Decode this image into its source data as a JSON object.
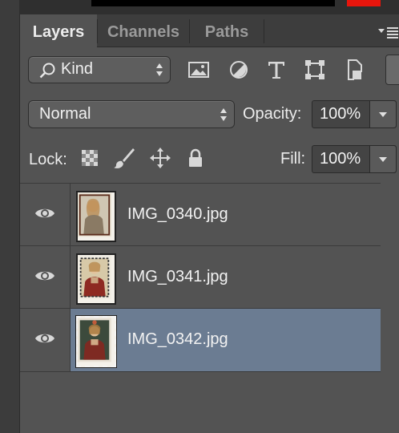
{
  "tabs": [
    {
      "label": "Layers",
      "active": true
    },
    {
      "label": "Channels",
      "active": false
    },
    {
      "label": "Paths",
      "active": false
    }
  ],
  "filter": {
    "kind_label": "Kind",
    "icons": [
      "image-filter-icon",
      "adjustment-filter-icon",
      "type-filter-icon",
      "shape-filter-icon",
      "smart-object-filter-icon"
    ]
  },
  "blend": {
    "mode": "Normal",
    "opacity_label": "Opacity:",
    "opacity_value": "100%"
  },
  "lock": {
    "label": "Lock:",
    "fill_label": "Fill:",
    "fill_value": "100%",
    "icons": [
      "lock-transparent-pixels-icon",
      "lock-image-pixels-icon",
      "lock-position-icon",
      "lock-all-icon"
    ]
  },
  "layers": [
    {
      "name": "IMG_0340.jpg",
      "visible": true,
      "selected": false
    },
    {
      "name": "IMG_0341.jpg",
      "visible": true,
      "selected": false
    },
    {
      "name": "IMG_0342.jpg",
      "visible": true,
      "selected": true
    }
  ],
  "colors": {
    "panel": "#535353",
    "selected_row": "#6b7c92",
    "accent_red": "#e8150c"
  }
}
